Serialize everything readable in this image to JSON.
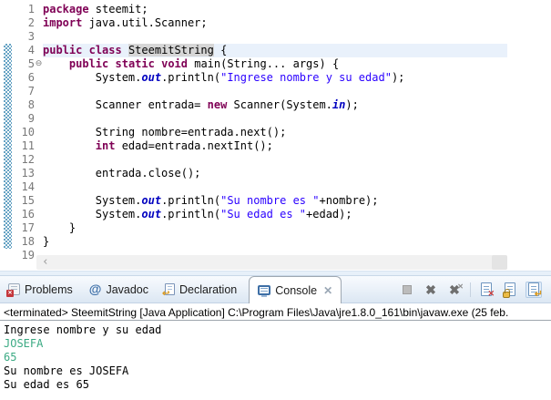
{
  "editor": {
    "range_indicator": {
      "from_line": 4,
      "to_line": 18
    },
    "occurrence_word": "SteemitString",
    "lines": [
      {
        "n": "1",
        "tokens": [
          {
            "c": "kw",
            "t": "package"
          },
          {
            "c": "pl",
            "t": " steemit;"
          }
        ]
      },
      {
        "n": "2",
        "tokens": [
          {
            "c": "kw",
            "t": "import"
          },
          {
            "c": "pl",
            "t": " java.util.Scanner;"
          }
        ]
      },
      {
        "n": "3",
        "tokens": []
      },
      {
        "n": "4",
        "current": true,
        "tokens": [
          {
            "c": "kw",
            "t": "public"
          },
          {
            "c": "pl",
            "t": " "
          },
          {
            "c": "kw",
            "t": "class"
          },
          {
            "c": "pl",
            "t": " "
          },
          {
            "c": "occ",
            "t": "SteemitString"
          },
          {
            "c": "pl",
            "t": " {"
          }
        ]
      },
      {
        "n": "5",
        "fold": true,
        "tokens": [
          {
            "c": "pl",
            "t": "    "
          },
          {
            "c": "kw",
            "t": "public"
          },
          {
            "c": "pl",
            "t": " "
          },
          {
            "c": "kw",
            "t": "static"
          },
          {
            "c": "pl",
            "t": " "
          },
          {
            "c": "kw",
            "t": "void"
          },
          {
            "c": "pl",
            "t": " main(String... args) {"
          }
        ]
      },
      {
        "n": "6",
        "tokens": [
          {
            "c": "pl",
            "t": "        System."
          },
          {
            "c": "fld",
            "t": "out"
          },
          {
            "c": "pl",
            "t": ".println("
          },
          {
            "c": "str",
            "t": "\"Ingrese nombre y su edad\""
          },
          {
            "c": "pl",
            "t": ");"
          }
        ]
      },
      {
        "n": "7",
        "tokens": []
      },
      {
        "n": "8",
        "tokens": [
          {
            "c": "pl",
            "t": "        Scanner entrada= "
          },
          {
            "c": "kw",
            "t": "new"
          },
          {
            "c": "pl",
            "t": " Scanner(System."
          },
          {
            "c": "fld",
            "t": "in"
          },
          {
            "c": "pl",
            "t": ");"
          }
        ]
      },
      {
        "n": "9",
        "tokens": []
      },
      {
        "n": "10",
        "tokens": [
          {
            "c": "pl",
            "t": "        String nombre=entrada.next();"
          }
        ]
      },
      {
        "n": "11",
        "tokens": [
          {
            "c": "pl",
            "t": "        "
          },
          {
            "c": "kw",
            "t": "int"
          },
          {
            "c": "pl",
            "t": " edad=entrada.nextInt();"
          }
        ]
      },
      {
        "n": "12",
        "tokens": []
      },
      {
        "n": "13",
        "tokens": [
          {
            "c": "pl",
            "t": "        entrada.close();"
          }
        ]
      },
      {
        "n": "14",
        "tokens": []
      },
      {
        "n": "15",
        "tokens": [
          {
            "c": "pl",
            "t": "        System."
          },
          {
            "c": "fld",
            "t": "out"
          },
          {
            "c": "pl",
            "t": ".println("
          },
          {
            "c": "str",
            "t": "\"Su nombre es \""
          },
          {
            "c": "pl",
            "t": "+nombre);"
          }
        ]
      },
      {
        "n": "16",
        "tokens": [
          {
            "c": "pl",
            "t": "        System."
          },
          {
            "c": "fld",
            "t": "out"
          },
          {
            "c": "pl",
            "t": ".println("
          },
          {
            "c": "str",
            "t": "\"Su edad es \""
          },
          {
            "c": "pl",
            "t": "+edad);"
          }
        ]
      },
      {
        "n": "17",
        "tokens": [
          {
            "c": "pl",
            "t": "    }"
          }
        ]
      },
      {
        "n": "18",
        "tokens": [
          {
            "c": "pl",
            "t": "}"
          }
        ]
      },
      {
        "n": "19",
        "tokens": []
      }
    ]
  },
  "tabs": [
    {
      "label": "Problems",
      "icon": "problems-icon",
      "active": false
    },
    {
      "label": "Javadoc",
      "icon": "javadoc-icon",
      "active": false
    },
    {
      "label": "Declaration",
      "icon": "declaration-icon",
      "active": false
    },
    {
      "label": "Console",
      "icon": "console-icon",
      "active": true
    }
  ],
  "console_toolbar": {
    "icons": [
      "terminate-icon",
      "remove-launch-icon",
      "remove-all-terminated-icon",
      "clear-console-icon",
      "scroll-lock-icon",
      "display-selected-console-icon"
    ]
  },
  "console": {
    "header": "<terminated> SteemitString [Java Application] C:\\Program Files\\Java\\jre1.8.0_161\\bin\\javaw.exe (25 feb.",
    "lines": [
      {
        "type": "stdout",
        "text": "Ingrese nombre y su edad"
      },
      {
        "type": "stdin",
        "text": "JOSEFA"
      },
      {
        "type": "stdin",
        "text": "65"
      },
      {
        "type": "stdout",
        "text": "Su nombre es JOSEFA"
      },
      {
        "type": "stdout",
        "text": "Su edad es 65"
      }
    ]
  },
  "colors": {
    "kw": "#7F0055",
    "str": "#2A00FF",
    "fld": "#0000C0",
    "stdin_green": "#3BAA83",
    "hatch": "#66A3C4",
    "current_line": "#E9F1FB",
    "occurrence_bg": "#D6D6D6"
  }
}
